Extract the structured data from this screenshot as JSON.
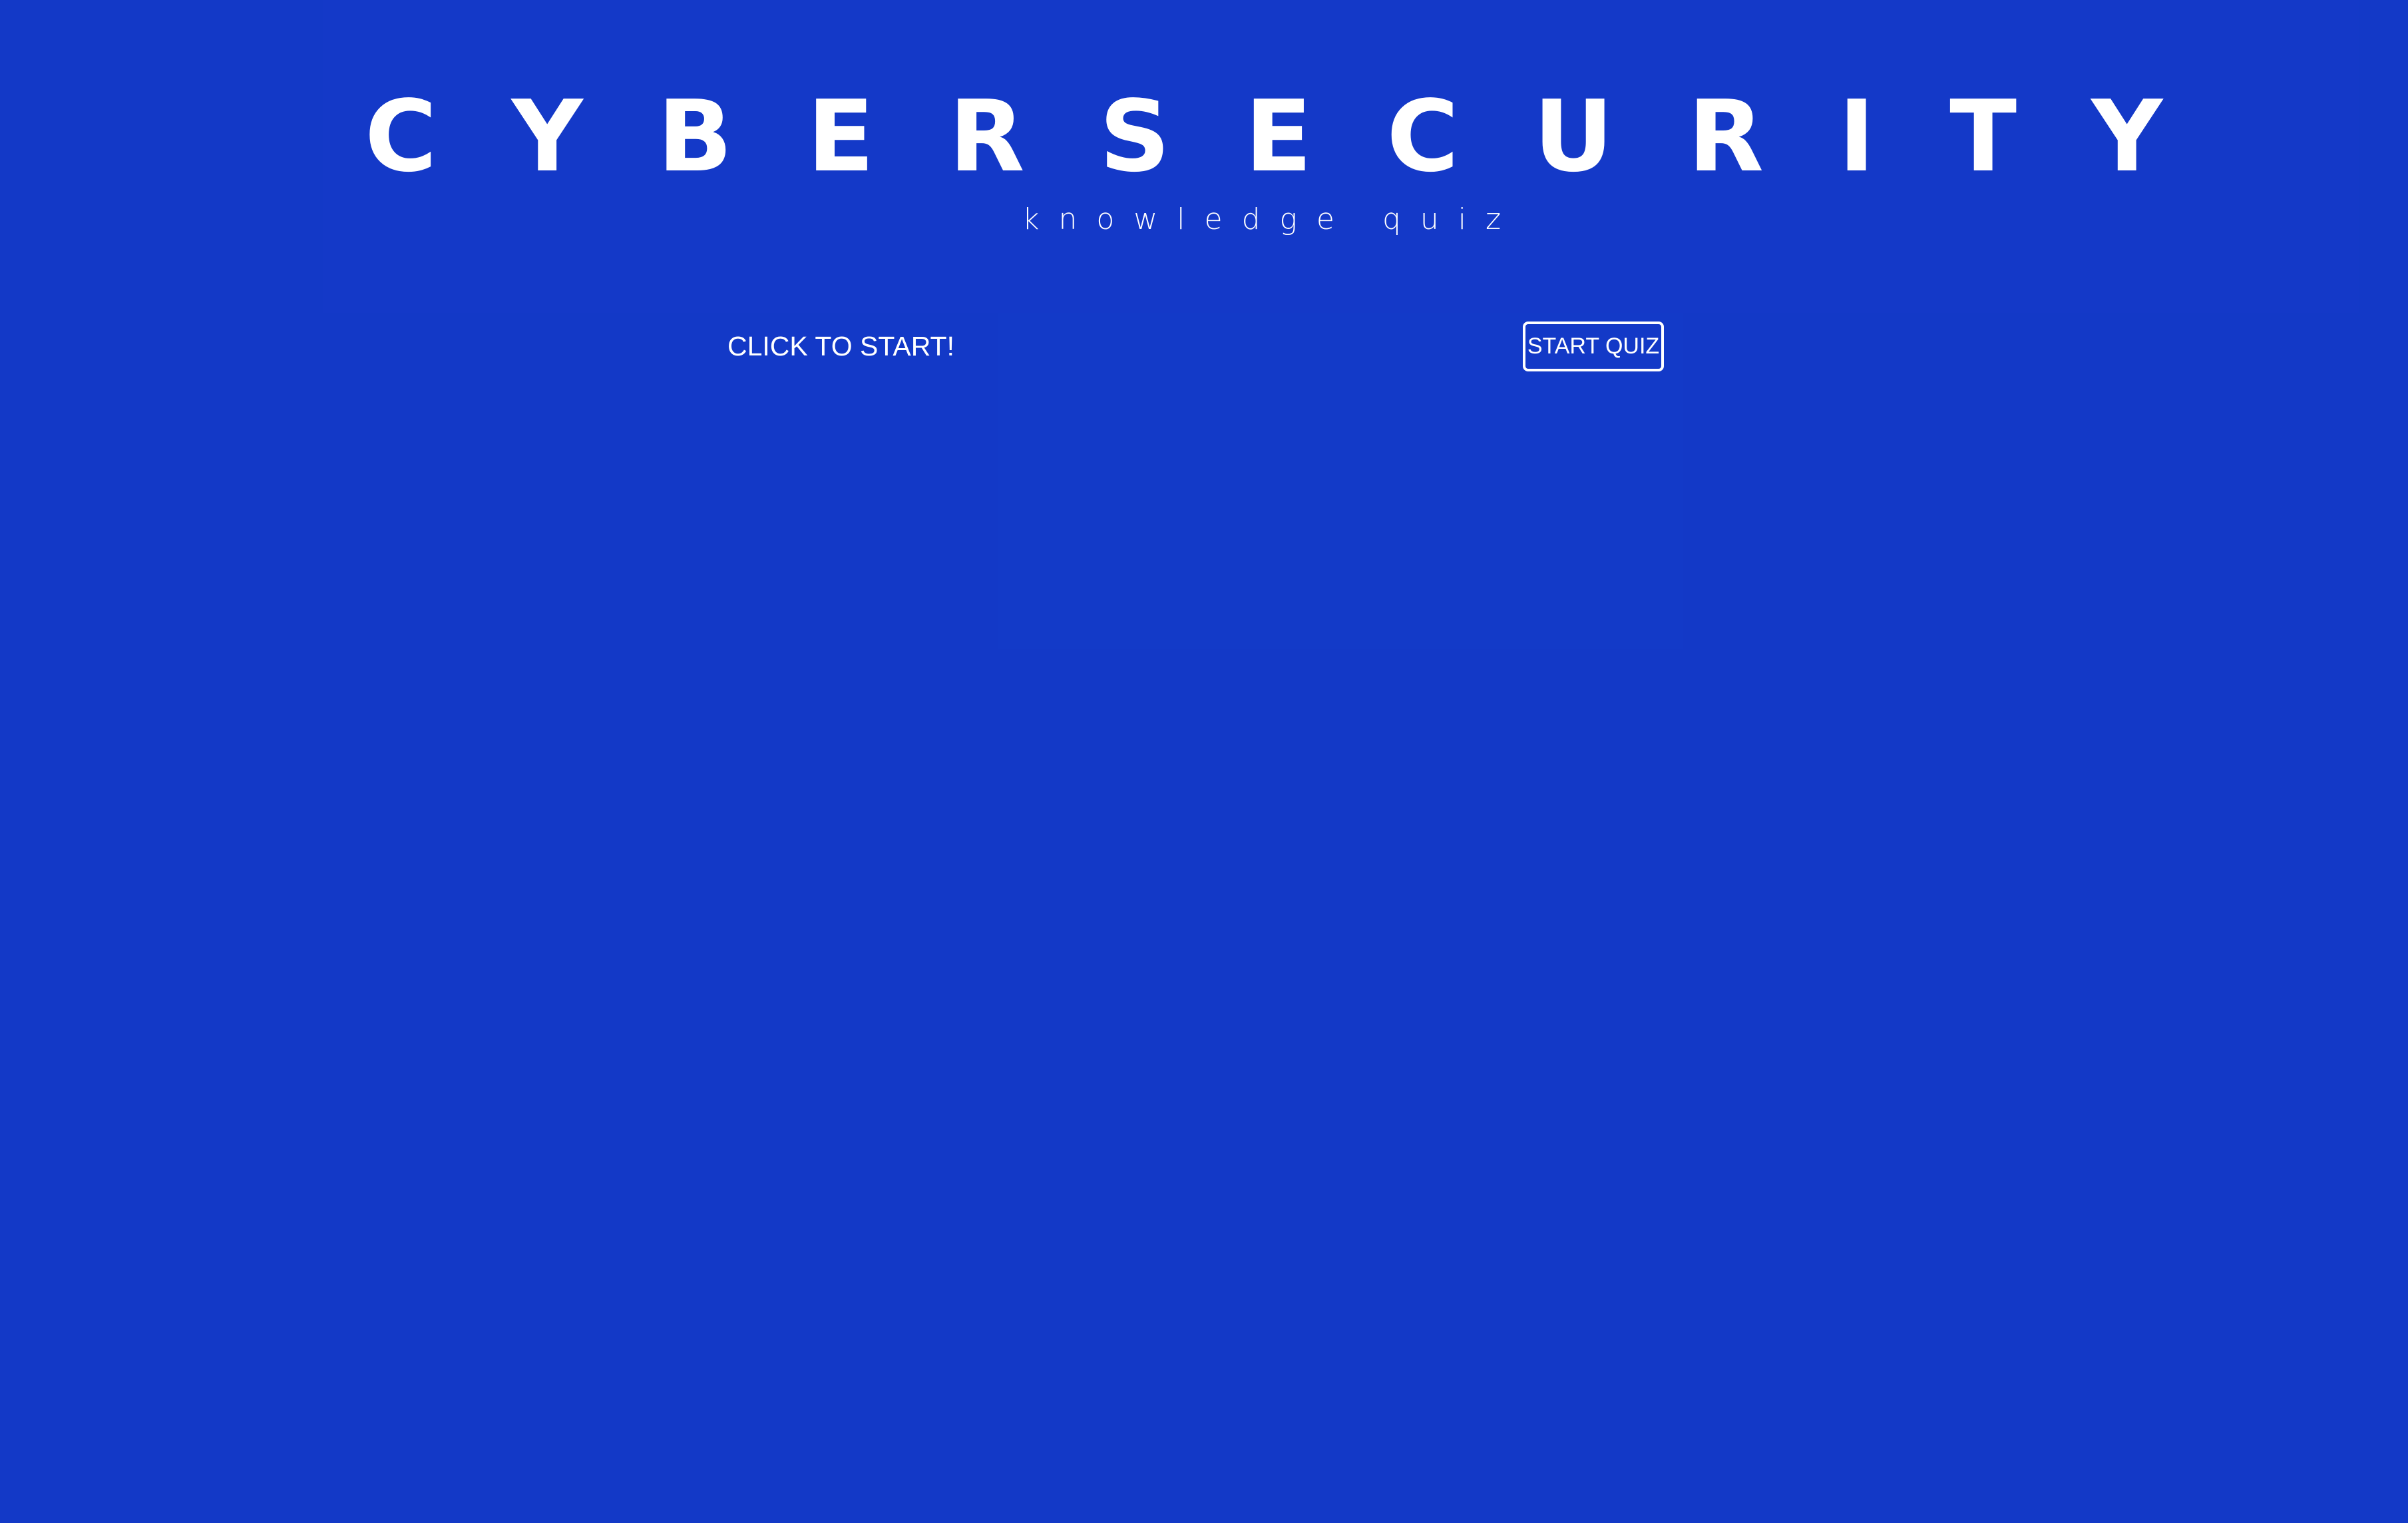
{
  "header": {
    "title": "CYBERSECURITY",
    "subtitle": "knowledge quiz"
  },
  "main": {
    "prompt": "CLICK TO START!",
    "start_button_label": "START QUIZ"
  },
  "colors": {
    "background": "#1339c7",
    "text": "#ffffff"
  }
}
